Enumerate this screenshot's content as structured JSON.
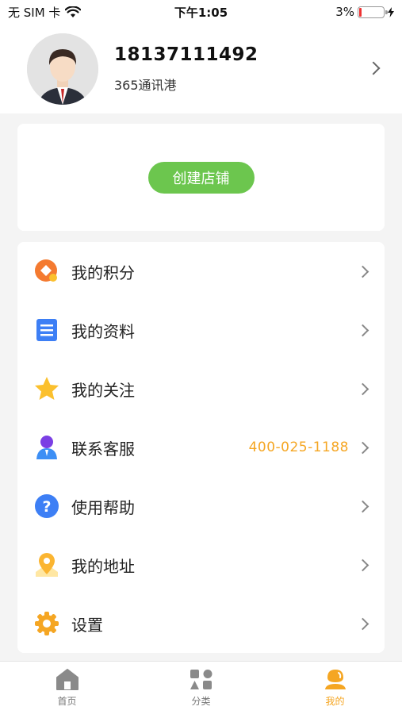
{
  "status_bar": {
    "carrier": "无 SIM 卡",
    "time": "下午1:05",
    "battery": "3%"
  },
  "profile": {
    "phone": "18137111492",
    "company": "365通讯港"
  },
  "store": {
    "create_label": "创建店铺"
  },
  "menu": [
    {
      "label": "我的积分",
      "icon": "points-icon"
    },
    {
      "label": "我的资料",
      "icon": "document-icon"
    },
    {
      "label": "我的关注",
      "icon": "star-icon"
    },
    {
      "label": "联系客服",
      "icon": "customer-service-icon",
      "extra": "400-025-1188"
    },
    {
      "label": "使用帮助",
      "icon": "help-icon"
    },
    {
      "label": "我的地址",
      "icon": "location-pin-icon"
    },
    {
      "label": "设置",
      "icon": "settings-gear-icon"
    }
  ],
  "tabs": [
    {
      "label": "首页",
      "icon": "home-icon"
    },
    {
      "label": "分类",
      "icon": "category-icon"
    },
    {
      "label": "我的",
      "icon": "profile-icon",
      "active": true
    }
  ],
  "colors": {
    "accent": "#f5a623",
    "create_button": "#6cc64e"
  }
}
